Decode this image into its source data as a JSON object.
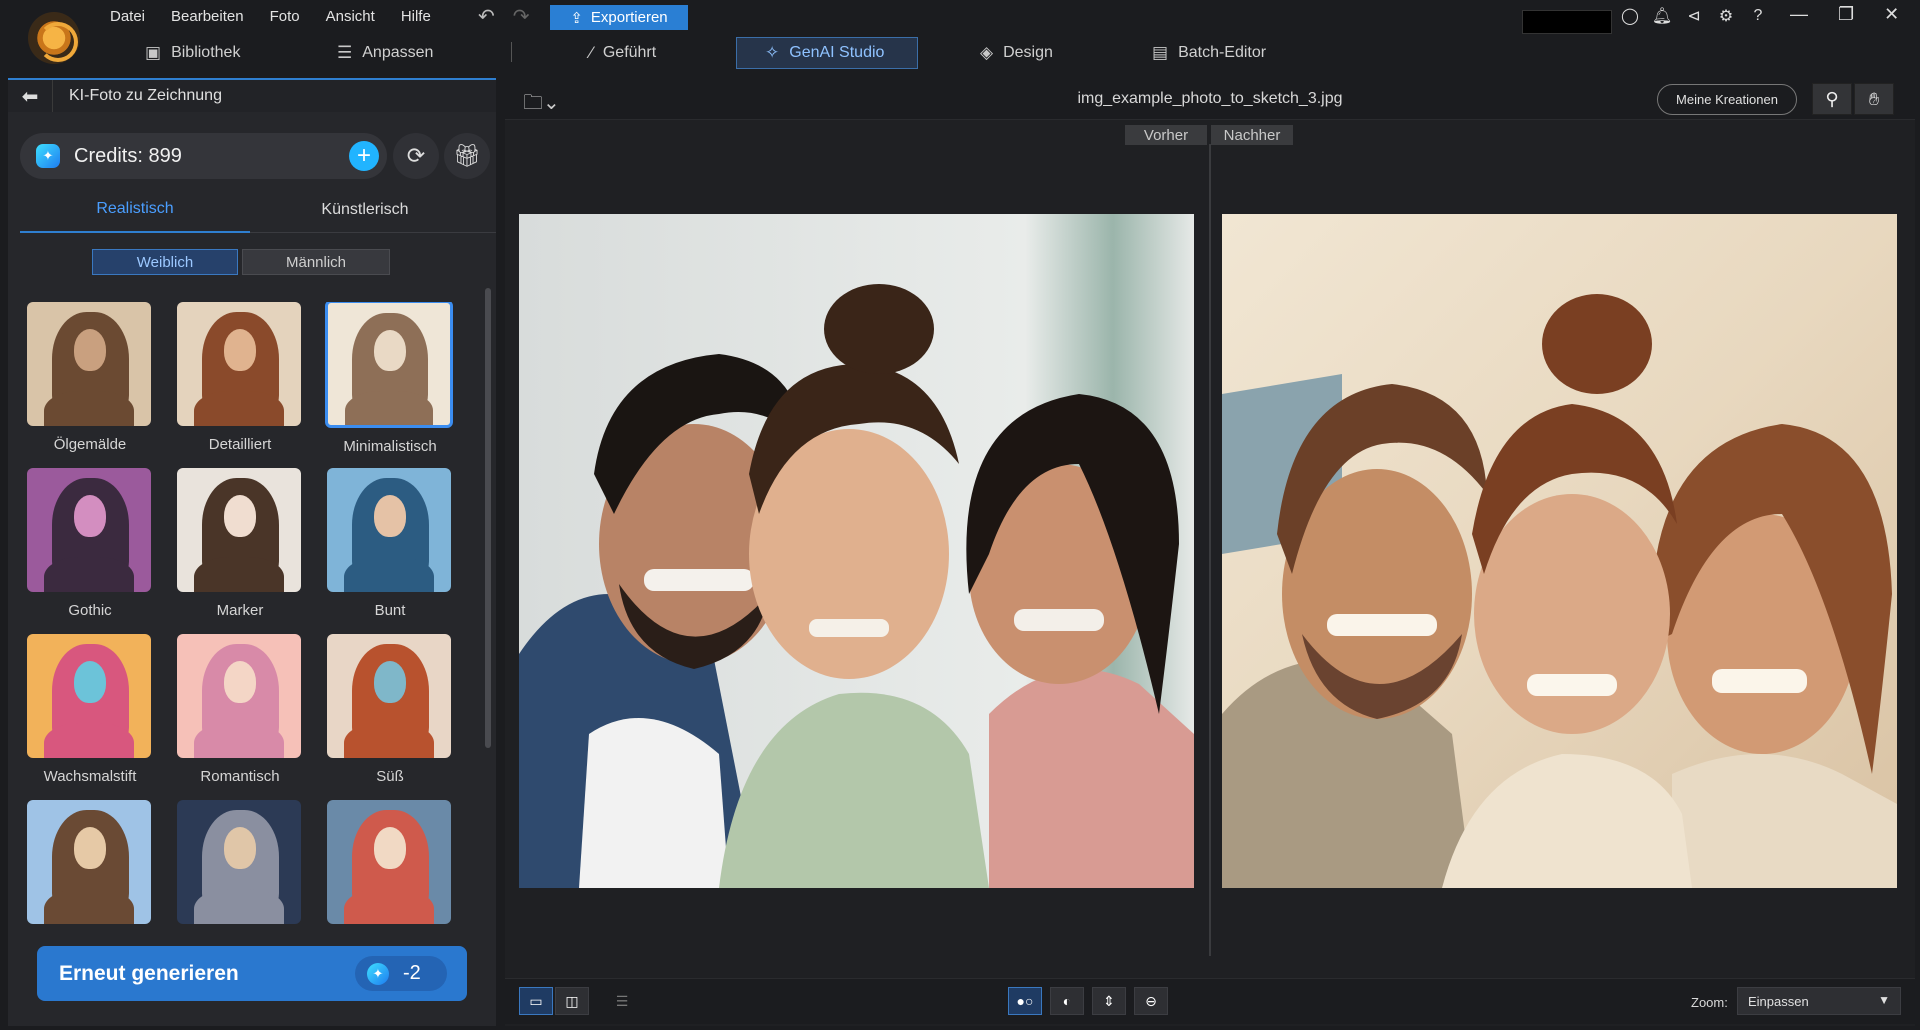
{
  "menu": [
    "Datei",
    "Bearbeiten",
    "Foto",
    "Ansicht",
    "Hilfe"
  ],
  "toolbar": {
    "export_label": "Exportieren"
  },
  "modes": [
    {
      "label": "Bibliothek",
      "icon": "library-icon"
    },
    {
      "label": "Anpassen",
      "icon": "sliders-icon"
    },
    {
      "label": "Geführt",
      "icon": "magic-wand-icon"
    },
    {
      "label": "GenAI Studio",
      "icon": "sparkle-icon",
      "active": true
    },
    {
      "label": "Design",
      "icon": "layers-icon"
    },
    {
      "label": "Batch-Editor",
      "icon": "batch-icon"
    }
  ],
  "panel": {
    "title": "KI-Foto zu Zeichnung",
    "credits": "Credits: 899",
    "tabs": [
      "Realistisch",
      "Künstlerisch"
    ],
    "active_tab": "Realistisch",
    "gender": [
      "Weiblich",
      "Männlich"
    ],
    "styles": [
      {
        "label": "Ölgemälde",
        "colors": [
          "#d9c4a8",
          "#6b4a32",
          "#c9a07f"
        ]
      },
      {
        "label": "Detailliert",
        "colors": [
          "#e4d3bd",
          "#8a4a2b",
          "#e0b38f"
        ]
      },
      {
        "label": "Minimalistisch",
        "colors": [
          "#efe6d7",
          "#8e6f57",
          "#e9d9c5"
        ],
        "selected": true
      },
      {
        "label": "Gothic",
        "colors": [
          "#9b5a9c",
          "#3b2a3f",
          "#d38ec0"
        ]
      },
      {
        "label": "Marker",
        "colors": [
          "#e9e3dc",
          "#4a3528",
          "#f0ddd0"
        ]
      },
      {
        "label": "Bunt",
        "colors": [
          "#7fb4d8",
          "#2c5c82",
          "#e5c2a6"
        ]
      },
      {
        "label": "Wachsmalstift",
        "colors": [
          "#f2b25a",
          "#d8577e",
          "#6cc3d9"
        ]
      },
      {
        "label": "Romantisch",
        "colors": [
          "#f6c1b8",
          "#d88aa8",
          "#f4d6c6"
        ]
      },
      {
        "label": "Süß",
        "colors": [
          "#e8d6c6",
          "#b8522e",
          "#7fb7c9"
        ]
      },
      {
        "label": "",
        "colors": [
          "#9fc3e6",
          "#6a4a34",
          "#e6c9a6"
        ]
      },
      {
        "label": "",
        "colors": [
          "#2c3a55",
          "#8a8fa0",
          "#e0c6a8"
        ]
      },
      {
        "label": "",
        "colors": [
          "#6a8aa8",
          "#cf5a4c",
          "#f1d9c4"
        ]
      }
    ],
    "regenerate": "Erneut generieren",
    "regenerate_cost": "-2"
  },
  "main": {
    "filename": "img_example_photo_to_sketch_3.jpg",
    "my_creations": "Meine Kreationen",
    "before": "Vorher",
    "after": "Nachher",
    "zoom_label": "Zoom:",
    "zoom_value": "Einpassen"
  },
  "colors": {
    "accent": "#2a78cf",
    "active_tab": "#4a9eff",
    "background": "#1f2023"
  }
}
